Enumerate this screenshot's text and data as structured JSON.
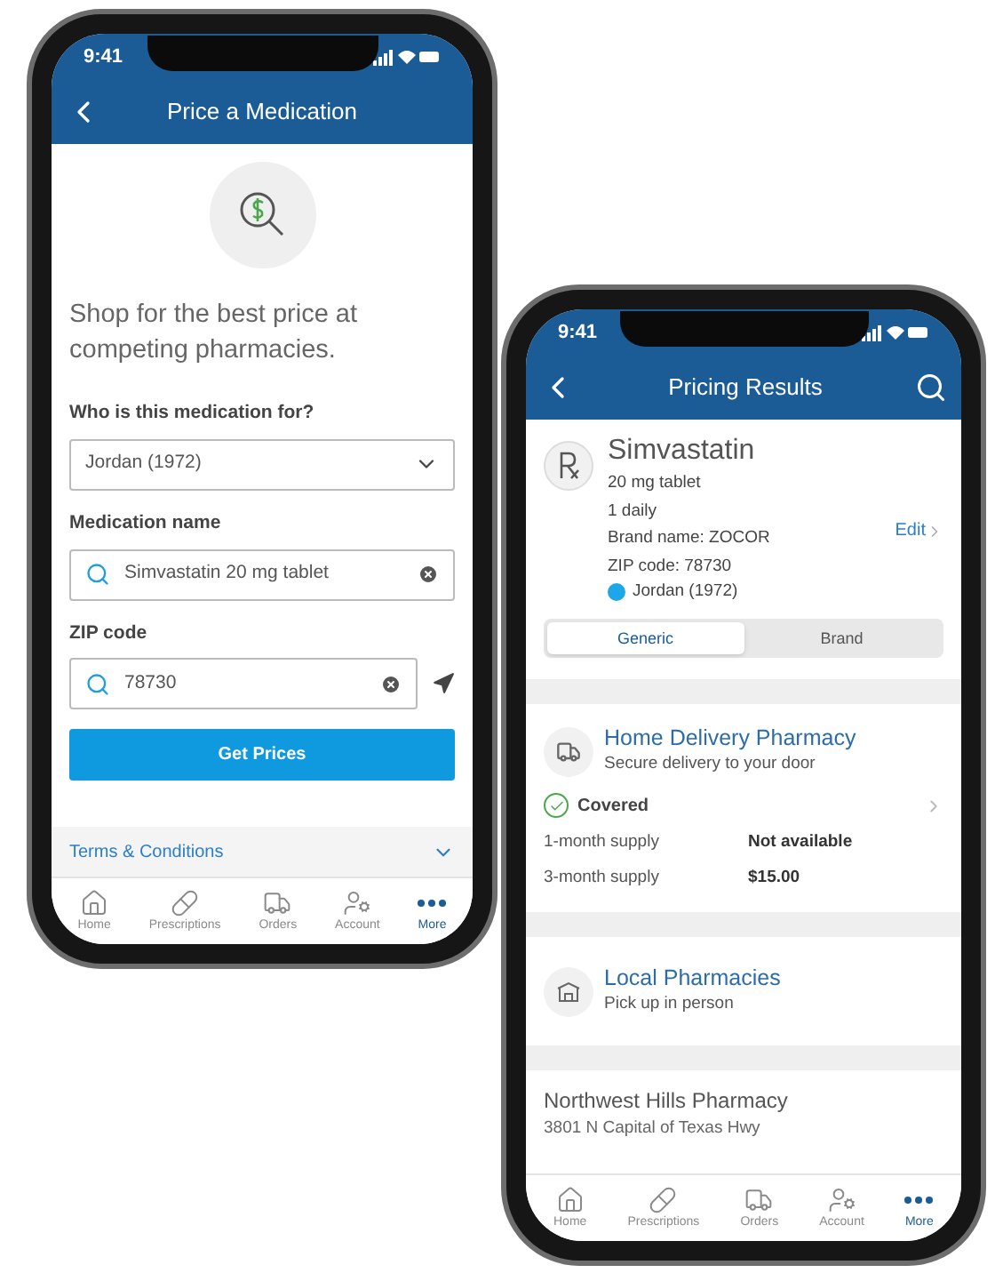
{
  "price_screen": {
    "status_time": "9:41",
    "title": "Price a Medication",
    "intro": "Shop for the best price at competing pharmacies.",
    "fields": [
      {
        "kind": "select",
        "label": "Who is this medication for?",
        "value": "Jordan (1972)"
      },
      {
        "kind": "search",
        "label": "Medication name",
        "value": "Simvastatin 20 mg tablet"
      },
      {
        "kind": "location",
        "label": "ZIP code",
        "value": "78730"
      }
    ],
    "button": "Get Prices",
    "terms": {
      "label": "Terms & Conditions",
      "expanded": false
    },
    "nav": [
      {
        "label": "Home",
        "selected": false
      },
      {
        "label": "Prescriptions",
        "selected": false
      },
      {
        "label": "Orders",
        "selected": false
      },
      {
        "label": "Account",
        "selected": false
      },
      {
        "label": "More",
        "selected": true
      }
    ]
  },
  "results_screen": {
    "status_time": "9:41",
    "title": "Pricing Results",
    "medication": {
      "name": "Simvastatin",
      "details": [
        "20 mg tablet",
        "1 daily",
        "Brand name: ZOCOR",
        "ZIP code: 78730"
      ],
      "member": {
        "name": "Jordan (1972)",
        "color": "#1ea7e8"
      },
      "edit": "Edit"
    },
    "type_toggle": [
      {
        "label": "Generic",
        "selected": true
      },
      {
        "label": "Brand",
        "selected": false
      }
    ],
    "home_delivery": {
      "title": "Home Delivery Pharmacy",
      "subtitle": "Secure delivery to your door",
      "status": "Covered",
      "covered": true,
      "rows": [
        {
          "label": "1-month supply",
          "value": "Not available"
        },
        {
          "label": "3-month supply",
          "value": "$15.00"
        }
      ]
    },
    "local": {
      "title": "Local Pharmacies",
      "subtitle": "Pick up in person"
    },
    "pharmacies": [
      {
        "name": "Northwest Hills Pharmacy",
        "address": "3801 N Capital of Texas Hwy"
      }
    ],
    "nav": [
      {
        "label": "Home",
        "selected": false
      },
      {
        "label": "Prescriptions",
        "selected": false
      },
      {
        "label": "Orders",
        "selected": false
      },
      {
        "label": "Account",
        "selected": false
      },
      {
        "label": "More",
        "selected": true
      }
    ]
  }
}
